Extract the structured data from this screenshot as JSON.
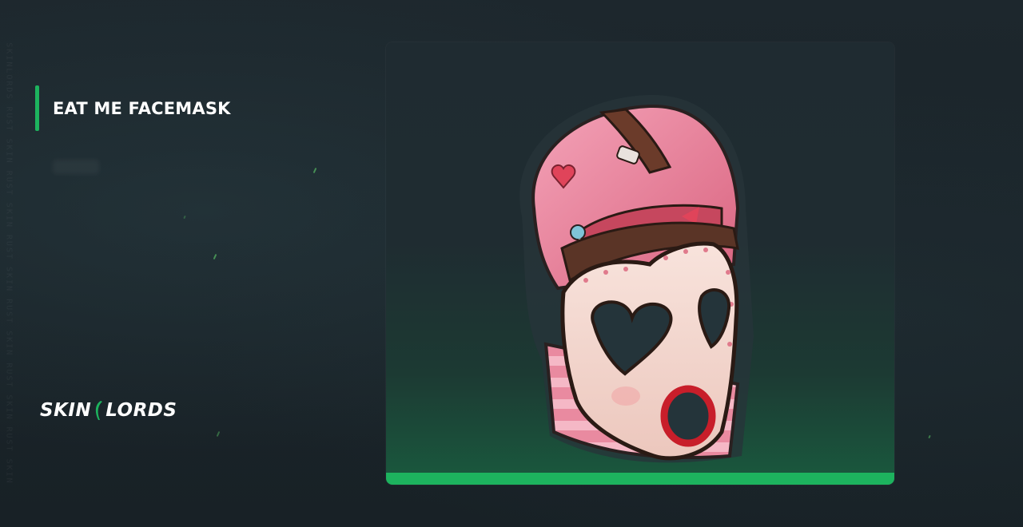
{
  "item": {
    "name": "EAT ME FACEMASK",
    "icon": "facemask-image"
  },
  "brand": {
    "name_left": "SKIN",
    "name_right": "LORDS",
    "watermark": "SKINLORDS RUST SKIN RUST SKIN RUST SKIN RUST SKIN RUST SKIN RUST SKIN"
  },
  "colors": {
    "accent": "#1db35e",
    "background": "#1a2329",
    "text": "#ffffff"
  }
}
